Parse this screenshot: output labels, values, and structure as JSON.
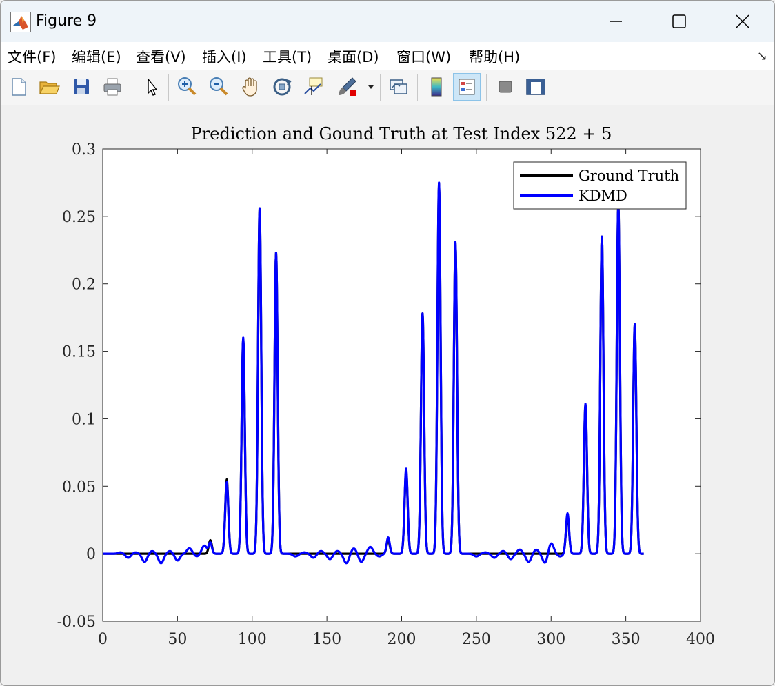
{
  "window": {
    "title": "Figure 9",
    "controls": {
      "minimize": "minimize-icon",
      "maximize": "maximize-icon",
      "close": "close-icon"
    }
  },
  "menu": {
    "items": [
      "文件(F)",
      "编辑(E)",
      "查看(V)",
      "插入(I)",
      "工具(T)",
      "桌面(D)",
      "窗口(W)",
      "帮助(H)"
    ],
    "overflow_icon": "dock-arrow-icon"
  },
  "toolbar": {
    "tools": [
      "new-figure-icon",
      "open-file-icon",
      "save-icon",
      "print-icon",
      "edit-plot-arrow-icon",
      "zoom-in-icon",
      "zoom-out-icon",
      "pan-hand-icon",
      "rotate-3d-icon",
      "data-cursor-icon",
      "brush-icon",
      "link-plot-icon",
      "colorbar-icon",
      "legend-icon",
      "hide-plot-tools-icon",
      "show-plot-tools-icon"
    ],
    "active_tool": "legend-icon"
  },
  "chart_data": {
    "type": "line",
    "title": "Prediction and Gound Truth at Test Index 522 + 5",
    "xlabel": "",
    "ylabel": "",
    "xlim": [
      0,
      400
    ],
    "ylim": [
      -0.05,
      0.3
    ],
    "xticks": [
      0,
      50,
      100,
      150,
      200,
      250,
      300,
      350,
      400
    ],
    "xtick_labels": [
      "0",
      "50",
      "100",
      "150",
      "200",
      "250",
      "300",
      "350",
      "400"
    ],
    "yticks": [
      -0.05,
      0,
      0.05,
      0.1,
      0.15,
      0.2,
      0.25,
      0.3
    ],
    "ytick_labels": [
      "-0.05",
      "0",
      "0.05",
      "0.1",
      "0.15",
      "0.2",
      "0.25",
      "0.3"
    ],
    "grid": false,
    "legend_placement": "top-right",
    "x_range": [
      0,
      362
    ],
    "series": [
      {
        "name": "Ground Truth",
        "color": "#000000",
        "peaks": [
          [
            72,
            0.01
          ],
          [
            83,
            0.055
          ],
          [
            94,
            0.159
          ],
          [
            105,
            0.256
          ],
          [
            116,
            0.223
          ],
          [
            191,
            0.01
          ],
          [
            203,
            0.061
          ],
          [
            214,
            0.178
          ],
          [
            225,
            0.274
          ],
          [
            236,
            0.23
          ],
          [
            311,
            0.028
          ],
          [
            323,
            0.11
          ],
          [
            334,
            0.235
          ],
          [
            345,
            0.26
          ],
          [
            356,
            0.17
          ]
        ],
        "ripples": []
      },
      {
        "name": "KDMD",
        "color": "#0000ff",
        "peaks": [
          [
            72,
            0.008
          ],
          [
            83,
            0.053
          ],
          [
            94,
            0.16
          ],
          [
            105,
            0.256
          ],
          [
            116,
            0.223
          ],
          [
            191,
            0.012
          ],
          [
            203,
            0.063
          ],
          [
            214,
            0.178
          ],
          [
            225,
            0.275
          ],
          [
            236,
            0.231
          ],
          [
            311,
            0.03
          ],
          [
            323,
            0.111
          ],
          [
            334,
            0.235
          ],
          [
            345,
            0.259
          ],
          [
            356,
            0.17
          ]
        ],
        "ripples": [
          [
            12,
            0.001
          ],
          [
            17,
            -0.003
          ],
          [
            22,
            0.001
          ],
          [
            28,
            -0.006
          ],
          [
            33,
            0.002
          ],
          [
            39,
            -0.007
          ],
          [
            45,
            0.002
          ],
          [
            50,
            -0.005
          ],
          [
            58,
            0.004
          ],
          [
            63,
            -0.002
          ],
          [
            68,
            0.006
          ],
          [
            129,
            -0.002
          ],
          [
            135,
            0.001
          ],
          [
            141,
            -0.003
          ],
          [
            146,
            0.002
          ],
          [
            152,
            -0.004
          ],
          [
            157,
            0.002
          ],
          [
            163,
            -0.007
          ],
          [
            168,
            0.004
          ],
          [
            173,
            -0.006
          ],
          [
            179,
            0.005
          ],
          [
            185,
            -0.002
          ],
          [
            250,
            -0.002
          ],
          [
            256,
            0.001
          ],
          [
            262,
            -0.003
          ],
          [
            268,
            0.002
          ],
          [
            273,
            -0.004
          ],
          [
            279,
            0.003
          ],
          [
            285,
            -0.006
          ],
          [
            290,
            0.003
          ],
          [
            296,
            -0.007
          ],
          [
            300,
            0.008
          ],
          [
            306,
            -0.002
          ]
        ]
      }
    ]
  }
}
